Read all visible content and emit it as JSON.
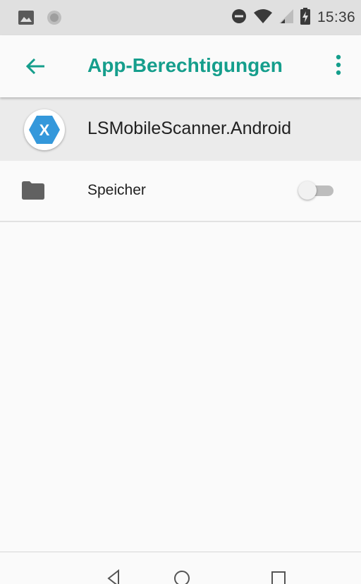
{
  "status_bar": {
    "time": "15:36",
    "left_icons": [
      "image-icon",
      "circle-notification-icon"
    ],
    "right_icons": [
      "do-not-disturb-icon",
      "wifi-icon",
      "signal-icon",
      "battery-charging-icon"
    ]
  },
  "app_bar": {
    "title": "App-Berechtigungen",
    "back_icon": "arrow-back-icon",
    "menu_icon": "more-vert-icon"
  },
  "app_header": {
    "app_name": "LSMobileScanner.Android",
    "icon_letter": "X"
  },
  "permissions": [
    {
      "label": "Speicher",
      "icon": "folder-icon",
      "enabled": false
    }
  ],
  "nav_bar": {
    "buttons": [
      "back-triangle-icon",
      "home-circle-icon",
      "recents-square-icon"
    ]
  },
  "colors": {
    "accent": "#159e8c",
    "status_bar": "#e0e0e0",
    "background": "#fafafa",
    "header_row": "#ebebeb",
    "app_icon_hex": "#3498db"
  }
}
